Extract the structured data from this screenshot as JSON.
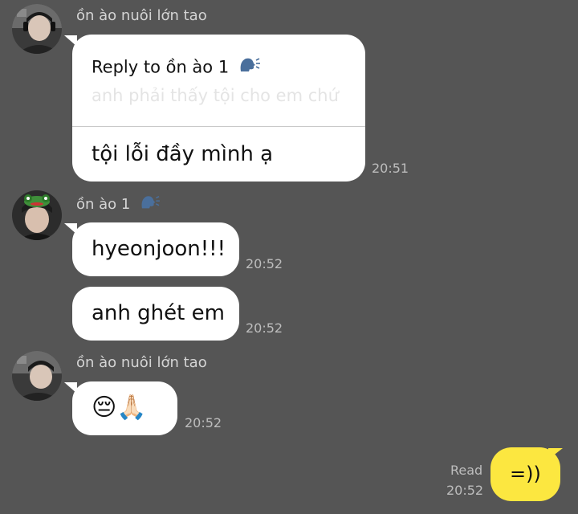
{
  "messages": {
    "group1": {
      "sender": "ồn ào nuôi lớn tao",
      "reply_title": "Reply to ồn ào 1",
      "reply_quote": "anh phải thấy tội cho em chứ",
      "body": "tội lỗi đầy mình ạ",
      "time": "20:51"
    },
    "group2": {
      "sender": "ồn ào 1",
      "msg1": "hyeonjoon!!!",
      "time1": "20:52",
      "msg2": "anh ghét em",
      "time2": "20:52"
    },
    "group3": {
      "sender": "ồn ào nuôi lớn tao",
      "emoji": "😔🙏🏻",
      "time": "20:52"
    },
    "mine": {
      "text": "=))",
      "status": "Read",
      "time": "20:52"
    }
  },
  "icons": {
    "speaker": "speaking-head-icon"
  },
  "colors": {
    "background": "#555555",
    "incoming_bubble": "#ffffff",
    "outgoing_bubble": "#fce740"
  }
}
